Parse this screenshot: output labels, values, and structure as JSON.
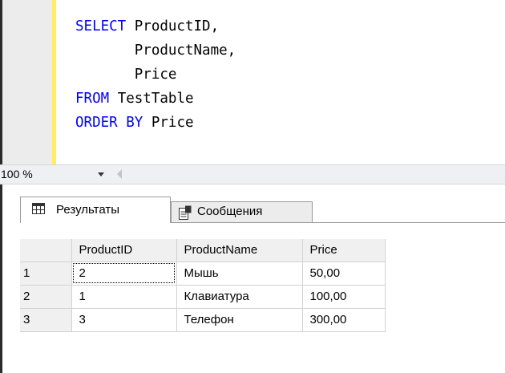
{
  "editor": {
    "lines": [
      [
        {
          "t": "SELECT",
          "c": "kw"
        },
        {
          "t": " ProductID,",
          "c": "id"
        }
      ],
      [
        {
          "t": "       ProductName,",
          "c": "id"
        }
      ],
      [
        {
          "t": "       Price",
          "c": "id"
        }
      ],
      [
        {
          "t": "FROM",
          "c": "kw"
        },
        {
          "t": " TestTable",
          "c": "id"
        }
      ],
      [
        {
          "t": "ORDER BY",
          "c": "kw"
        },
        {
          "t": " Price",
          "c": "id"
        }
      ]
    ],
    "keyword_color": "#0000ff",
    "change_bar_color": "#ffee62"
  },
  "zoom": {
    "label": "100 %"
  },
  "tabs": {
    "results_label": "Результаты",
    "messages_label": "Сообщения",
    "results_icon": "grid-icon",
    "messages_icon": "messages-icon"
  },
  "grid": {
    "columns": [
      "ProductID",
      "ProductName",
      "Price"
    ],
    "rows": [
      {
        "num": "1",
        "cells": [
          "2",
          "Мышь",
          "50,00"
        ]
      },
      {
        "num": "2",
        "cells": [
          "1",
          "Клавиатура",
          "100,00"
        ]
      },
      {
        "num": "3",
        "cells": [
          "3",
          "Телефон",
          "300,00"
        ]
      }
    ]
  }
}
